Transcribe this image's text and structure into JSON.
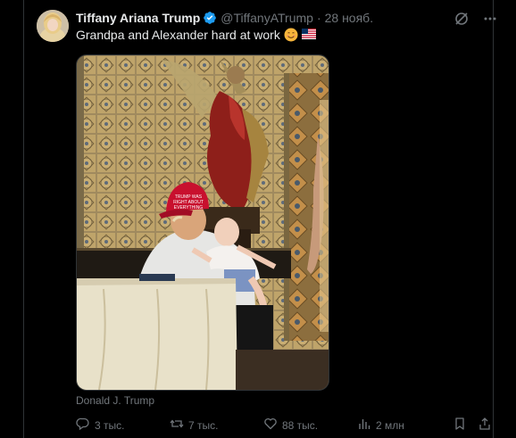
{
  "tweet": {
    "display_name": "Tiffany Ariana Trump",
    "handle": "@TiffanyATrump",
    "separator": "·",
    "date": "28 нояб.",
    "text": "Grandpa and Alexander hard at work",
    "media_caption": "Donald J. Trump"
  },
  "actions": {
    "replies": "3 тыс.",
    "reposts": "7 тыс.",
    "likes": "88 тыс.",
    "views": "2 млн"
  },
  "icons": {
    "verified": "verified-badge-icon",
    "grok": "grok-icon",
    "more": "more-icon",
    "reply": "reply-icon",
    "repost": "repost-icon",
    "like": "heart-icon",
    "views": "views-icon",
    "bookmark": "bookmark-icon",
    "share": "share-icon"
  },
  "colors": {
    "background": "#000000",
    "text": "#e7e9ea",
    "muted": "#71767b",
    "verified": "#1d9bf0",
    "border": "#2f3336"
  }
}
